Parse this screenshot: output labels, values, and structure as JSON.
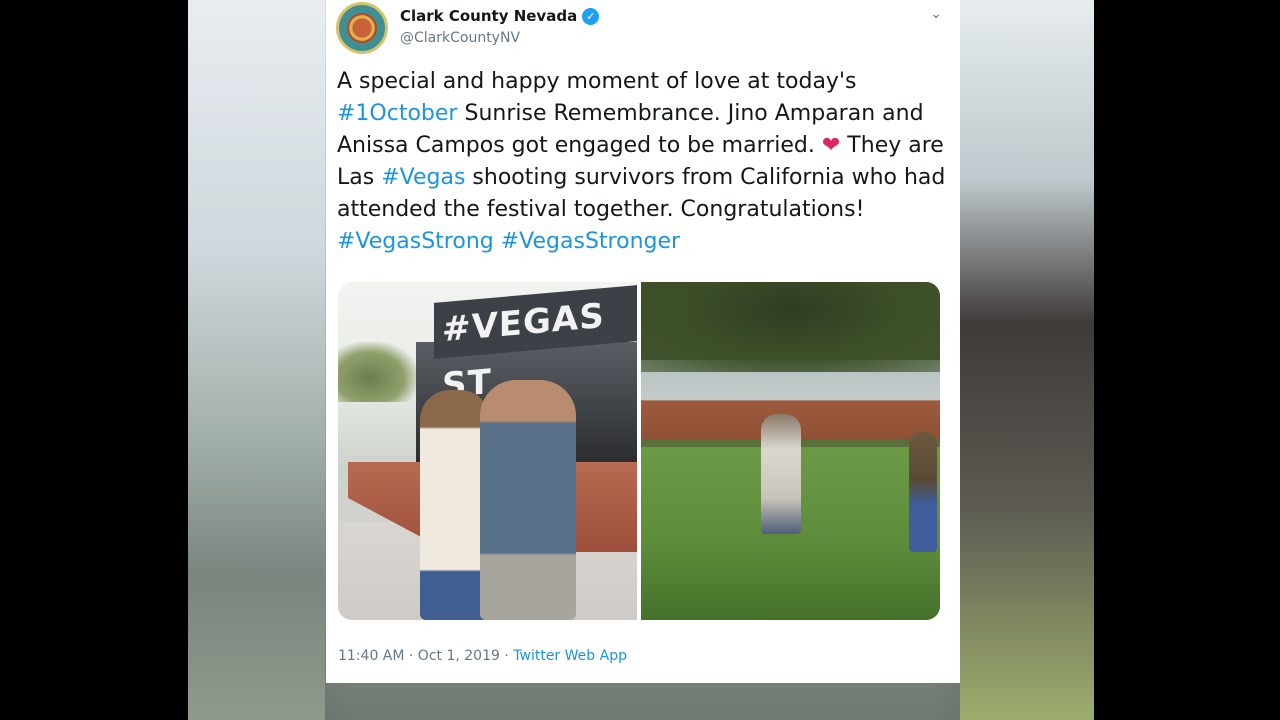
{
  "tweet": {
    "author_name": "Clark County Nevada",
    "author_handle": "@ClarkCountyNV",
    "text_parts": {
      "p1": "A special and happy moment of love at today's ",
      "tag1": "#1October",
      "p2": " Sunrise Remembrance. Jino Amparan and Anissa Campos got engaged to be married. ",
      "heart": "❤",
      "p3": " They are Las ",
      "tag2": "#Vegas",
      "p4": " shooting survivors from California who had attended the festival together. Congratulations! ",
      "tag3": "#VegasStrong",
      "space": " ",
      "tag4": "#VegasStronger"
    },
    "photo_left_sign": "#VEGAS ST",
    "timestamp": "11:40 AM · Oct 1, 2019",
    "separator": " · ",
    "source": "Twitter Web App"
  },
  "icons": {
    "verified": "verified-badge-icon",
    "menu": "chevron-down-icon"
  },
  "colors": {
    "link": "#1b95e0",
    "verified": "#1da1f2",
    "heart": "#e0245e",
    "text": "#14171a",
    "muted": "#657786"
  }
}
